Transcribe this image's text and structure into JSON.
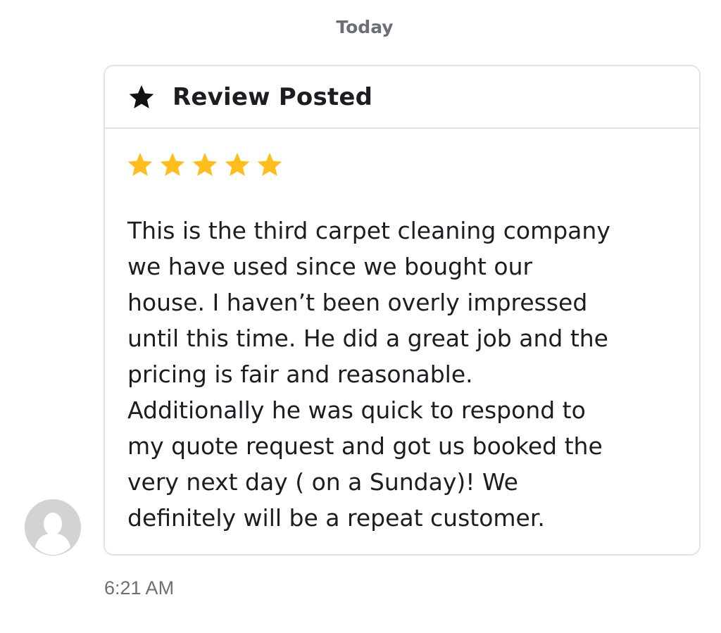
{
  "conversation": {
    "day_label": "Today",
    "timestamp": "6:21 AM"
  },
  "review_card": {
    "title": "Review Posted",
    "title_icon": "star-icon",
    "rating": 5,
    "rating_max": 5,
    "star_color": "#FFBE1E",
    "body": "This is the third carpet cleaning company\nwe have used since we bought our\nhouse. I haven’t been overly impressed\nuntil this time. He did a great job and the\npricing is fair and reasonable.\nAdditionally he was quick to respond to\nmy quote request and got us booked the\nvery next day ( on a Sunday)! We\ndefinitely will be a repeat customer."
  },
  "sender": {
    "avatar_icon": "default-user-avatar-icon",
    "avatar_color": "#D3D3D3"
  }
}
